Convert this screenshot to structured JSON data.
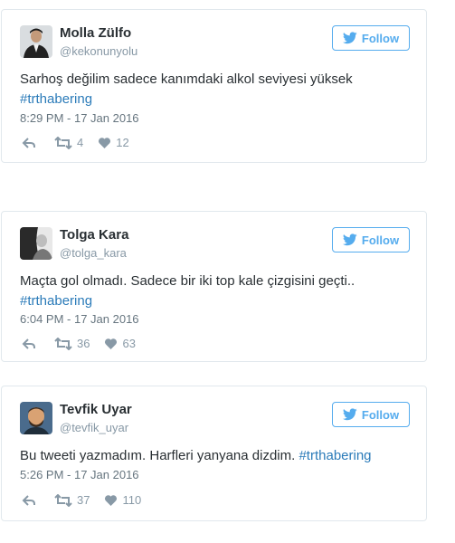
{
  "follow_label": "Follow",
  "colors": {
    "accent": "#55acee",
    "link": "#2b7bb9",
    "text": "#292f33",
    "muted": "#8899a6",
    "border": "#e1e8ed"
  },
  "tweets": [
    {
      "name": "Molla Zülfo",
      "handle": "@kekonunyolu",
      "text_line1": "Sarhoş değilim sadece kanımdaki alkol seviyesi yüksek",
      "hashtag": "#trthabering",
      "timestamp": "8:29 PM - 17 Jan 2016",
      "retweets": "4",
      "likes": "12"
    },
    {
      "name": "Tolga Kara",
      "handle": "@tolga_kara",
      "text_line1": "Maçta gol olmadı. Sadece bir iki top kale çizgisini geçti..",
      "hashtag": "#trthabering",
      "timestamp": "6:04 PM - 17 Jan 2016",
      "retweets": "36",
      "likes": "63"
    },
    {
      "name": "Tevfik Uyar",
      "handle": "@tevfik_uyar",
      "text_line1": "Bu tweeti yazmadım. Harfleri yanyana dizdim.",
      "hashtag": "#trthabering",
      "timestamp": "5:26 PM - 17 Jan 2016",
      "retweets": "37",
      "likes": "110"
    }
  ]
}
